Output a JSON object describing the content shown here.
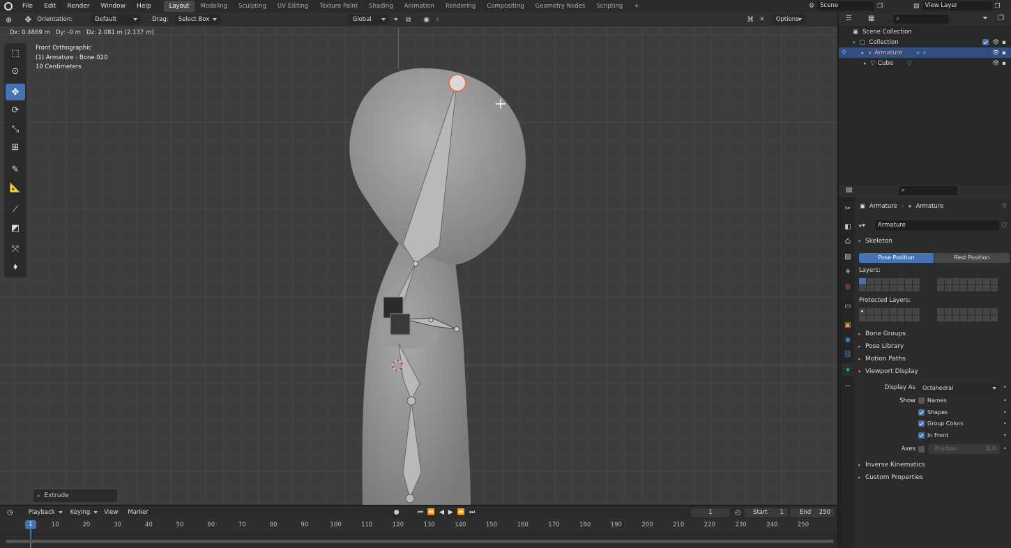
{
  "menu": [
    "File",
    "Edit",
    "Render",
    "Window",
    "Help"
  ],
  "workspaces": [
    "Layout",
    "Modeling",
    "Sculpting",
    "UV Editing",
    "Texture Paint",
    "Shading",
    "Animation",
    "Rendering",
    "Compositing",
    "Geometry Nodes",
    "Scripting"
  ],
  "active_workspace": "Layout",
  "scene": "Scene",
  "view_layer": "View Layer",
  "header": {
    "orientation_label": "Orientation:",
    "orientation_value": "Default",
    "drag_label": "Drag:",
    "drag_value": "Select Box",
    "transform_space": "Global",
    "options": "Options"
  },
  "status_line": "Dx: 0.4869 m   Dy: -0 m   Dz: 2.081 m (2.137 m)",
  "viewport_info": {
    "view": "Front Orthographic",
    "object": "(1) Armature : Bone.020",
    "scale": "10 Centimeters"
  },
  "operator_panel": "Extrude",
  "outliner": {
    "root": "Scene Collection",
    "collection": "Collection",
    "items": [
      {
        "name": "Armature",
        "selected": true
      },
      {
        "name": "Cube",
        "selected": false
      }
    ]
  },
  "properties": {
    "breadcrumb": [
      "Armature",
      "Armature"
    ],
    "data_name": "Armature",
    "skeleton": "Skeleton",
    "pose_position": "Pose Position",
    "rest_position": "Rest Position",
    "layers_label": "Layers:",
    "protected_layers_label": "Protected Layers:",
    "collapsed_sections": [
      "Bone Groups",
      "Pose Library",
      "Motion Paths"
    ],
    "viewport_display": "Viewport Display",
    "display_as_label": "Display As",
    "display_as_value": "Octahedral",
    "show_label": "Show",
    "show_options": [
      {
        "label": "Names",
        "checked": false
      },
      {
        "label": "Shapes",
        "checked": true
      },
      {
        "label": "Group Colors",
        "checked": true
      },
      {
        "label": "In Front",
        "checked": true
      }
    ],
    "axes_label": "Axes",
    "axes_position_label": "Position",
    "axes_position_value": "0.0",
    "bottom_sections": [
      "Inverse Kinematics",
      "Custom Properties"
    ]
  },
  "timeline": {
    "menus": [
      "Playback",
      "Keying",
      "View",
      "Marker"
    ],
    "current_frame": "1",
    "start_label": "Start",
    "start": "1",
    "end_label": "End",
    "end": "250",
    "ticks": [
      "1",
      "10",
      "20",
      "30",
      "40",
      "50",
      "60",
      "70",
      "80",
      "90",
      "100",
      "110",
      "120",
      "130",
      "140",
      "150",
      "160",
      "170",
      "180",
      "190",
      "200",
      "210",
      "220",
      "230",
      "240",
      "250"
    ]
  },
  "colors": {
    "accent": "#4772b3",
    "selected_bone": "#e07050",
    "x_axis": "#a03a3a",
    "z_axis": "#3a5fa0"
  }
}
